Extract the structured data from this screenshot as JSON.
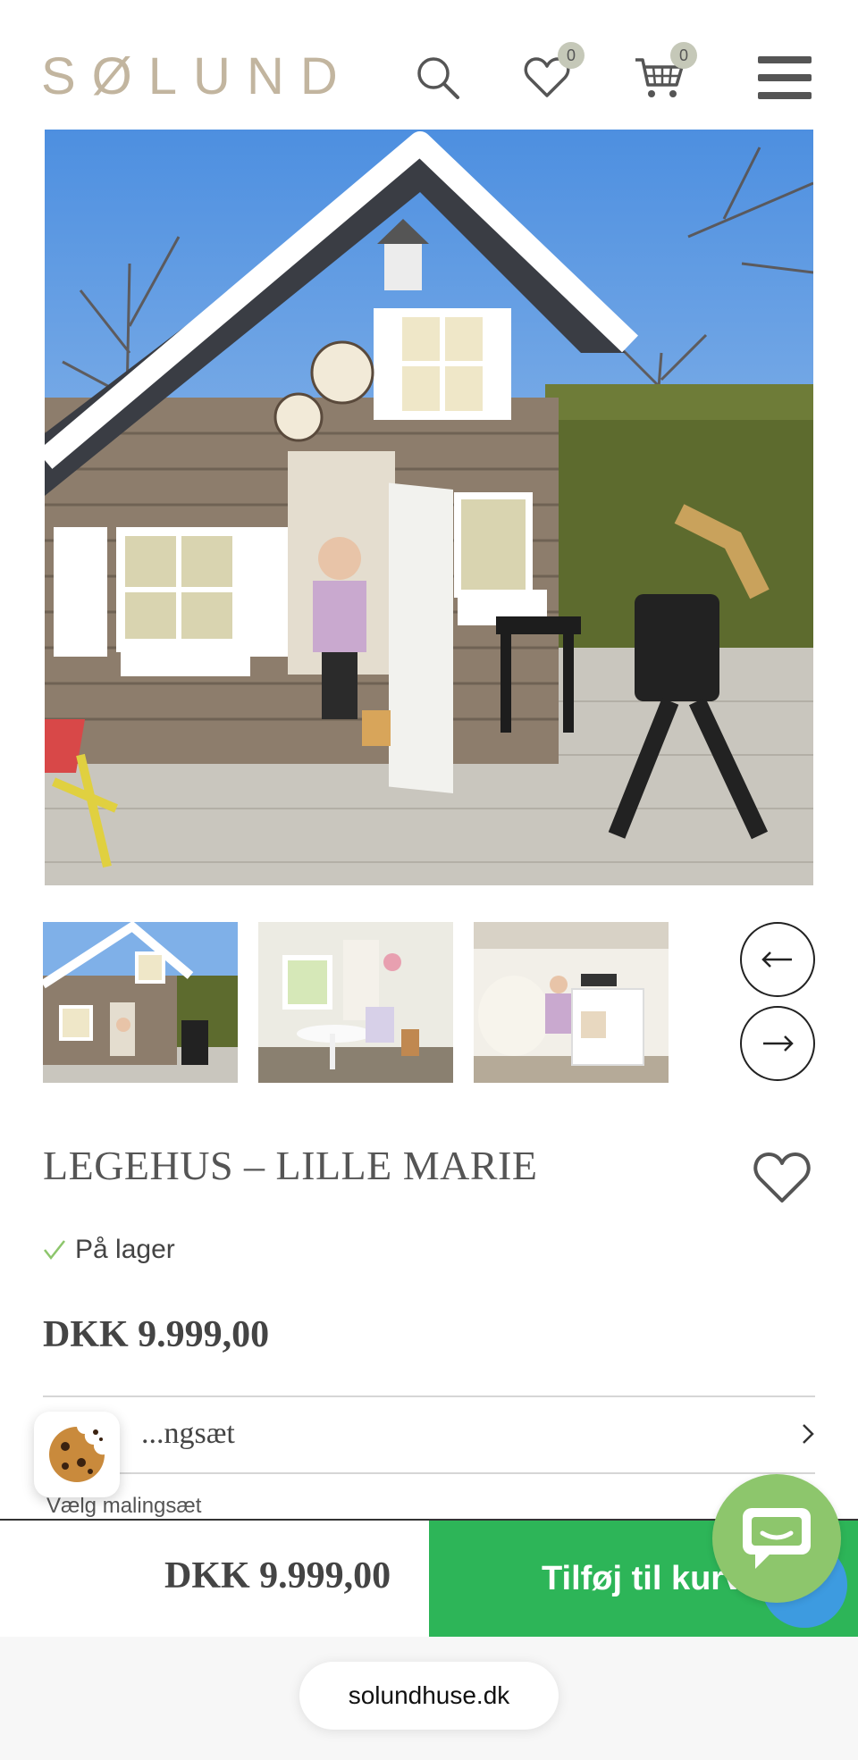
{
  "header": {
    "logo": "SØLUND",
    "wishlist_count": "0",
    "cart_count": "0"
  },
  "product": {
    "title": "LEGEHUS – LILLE MARIE",
    "stock_status": "På lager",
    "price": "DKK 9.999,00",
    "option_label": "Malingsæt",
    "option_visible_label": "...ngsæt",
    "option_sub": "Vælg malingsæt"
  },
  "bottom_bar": {
    "price": "DKK 9.999,00",
    "add_to_cart": "Tilføj til kurv"
  },
  "browser": {
    "url": "solundhuse.dk"
  },
  "colors": {
    "logo": "#c2b59f",
    "badge": "#c5c8b8",
    "add_button": "#2db558",
    "chat": "#8dc66c",
    "check": "#8dc66c"
  },
  "icons": {
    "search": "search-icon",
    "wishlist": "heart-icon",
    "cart": "cart-icon",
    "menu": "hamburger-menu-icon",
    "prev": "arrow-left-icon",
    "next": "arrow-right-icon",
    "chevron": "chevron-right-icon",
    "cookie": "cookie-icon",
    "chat": "chat-icon"
  }
}
